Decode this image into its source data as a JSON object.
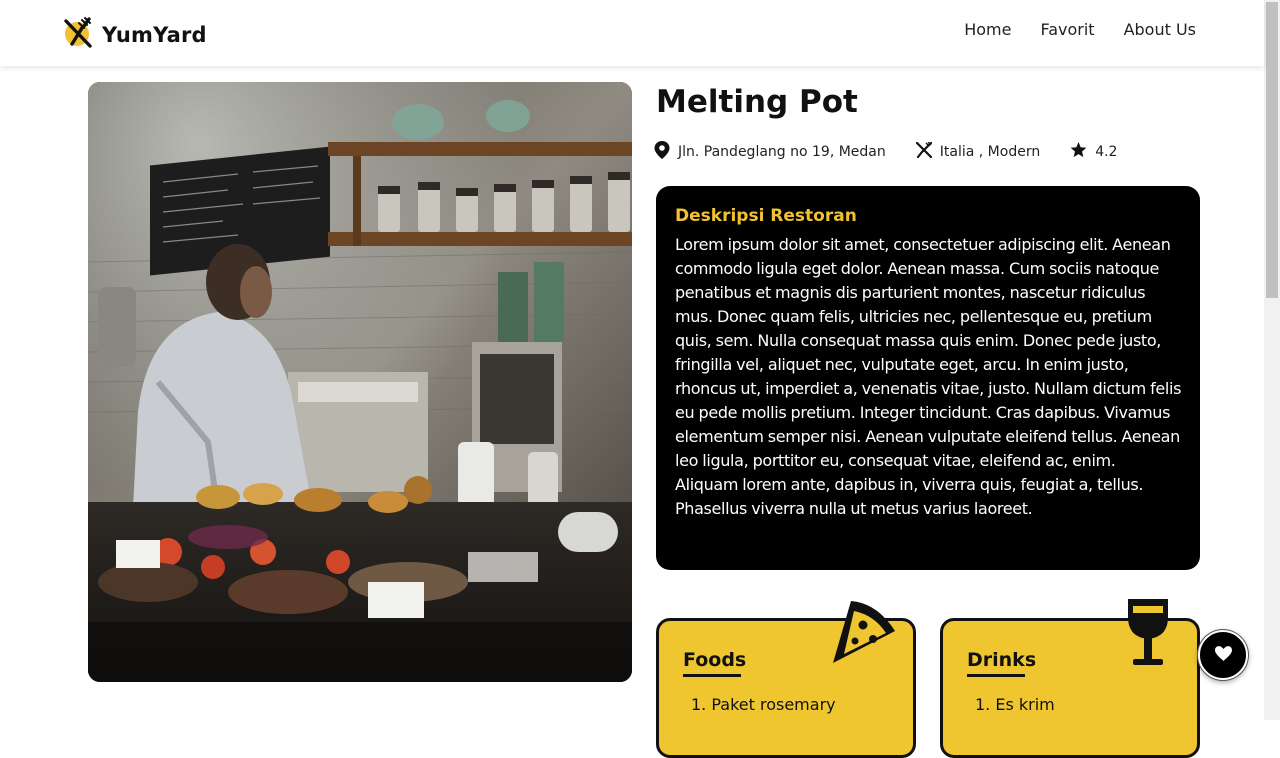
{
  "brand": {
    "name": "YumYard",
    "logo_icon": "fork-knife-icon",
    "accent": "#f2c12e"
  },
  "nav": {
    "links": [
      "Home",
      "Favorit",
      "About Us"
    ]
  },
  "restaurant": {
    "name": "Melting Pot",
    "address": "Jln. Pandeglang no 19, Medan",
    "cuisine": "Italia , Modern",
    "rating": "4.2",
    "image_alt": "Cafe interior with a barista at the counter"
  },
  "description": {
    "title": "Deskripsi Restoran",
    "text": "Lorem ipsum dolor sit amet, consectetuer adipiscing elit. Aenean commodo ligula eget dolor. Aenean massa. Cum sociis natoque penatibus et magnis dis parturient montes, nascetur ridiculus mus. Donec quam felis, ultricies nec, pellentesque eu, pretium quis, sem. Nulla consequat massa quis enim. Donec pede justo, fringilla vel, aliquet nec, vulputate eget, arcu. In enim justo, rhoncus ut, imperdiet a, venenatis vitae, justo. Nullam dictum felis eu pede mollis pretium. Integer tincidunt. Cras dapibus. Vivamus elementum semper nisi. Aenean vulputate eleifend tellus. Aenean leo ligula, porttitor eu, consequat vitae, eleifend ac, enim. Aliquam lorem ante, dapibus in, viverra quis, feugiat a, tellus. Phasellus viverra nulla ut metus varius laoreet."
  },
  "menus": {
    "foods": {
      "heading": "Foods",
      "icon": "pizza-icon",
      "items": [
        "1. Paket rosemary"
      ]
    },
    "drinks": {
      "heading": "Drinks",
      "icon": "wine-glass-icon",
      "items": [
        "1. Es krim"
      ]
    }
  },
  "fab": {
    "icon": "heart-icon"
  }
}
